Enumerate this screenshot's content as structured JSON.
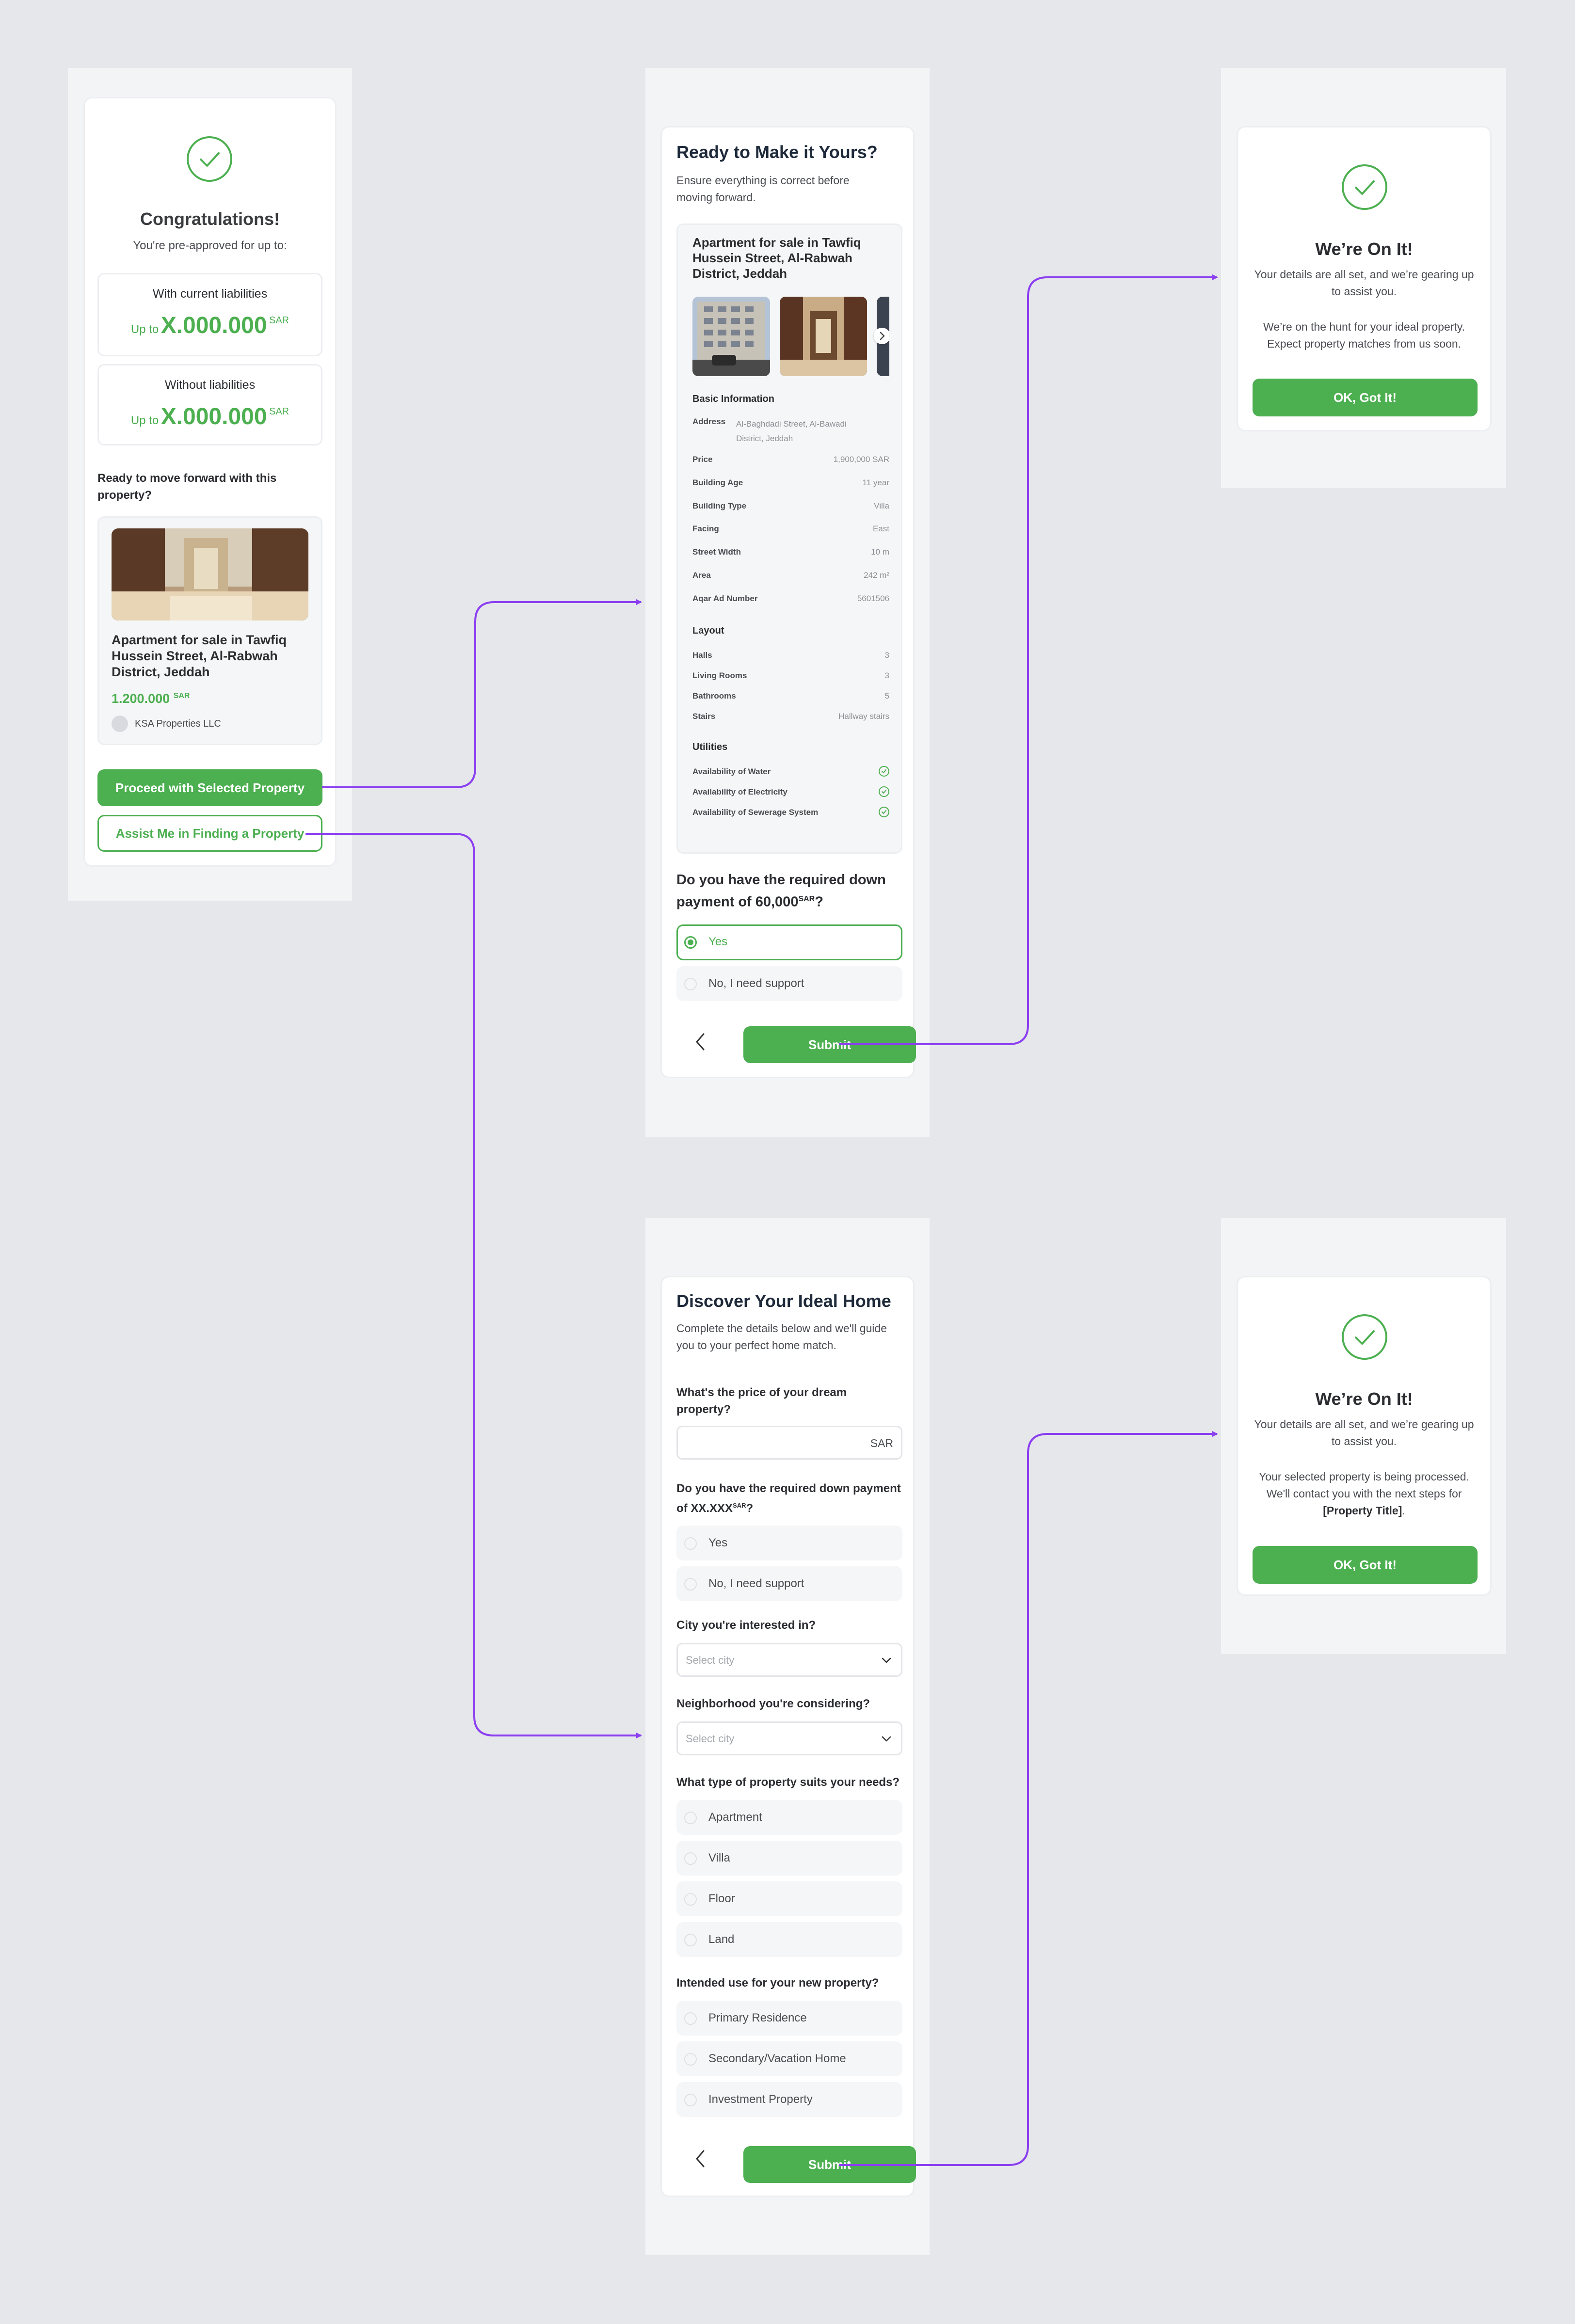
{
  "screen1": {
    "title": "Congratulations!",
    "subtitle": "You're pre-approved for up to:",
    "with_liabilities": {
      "label": "With current liabilities",
      "prefix": "Up to",
      "amount": "X.000.000",
      "currency": "SAR"
    },
    "without_liabilities": {
      "label": "Without liabilities",
      "prefix": "Up to",
      "amount": "X.000.000",
      "currency": "SAR"
    },
    "question": "Ready to move forward with this property?",
    "property": {
      "title": "Apartment for sale in Tawfiq Hussein Street, Al-Rabwah District, Jeddah",
      "price": "1.200.000",
      "currency": "SAR",
      "agency": "KSA Properties LLC"
    },
    "proceed_button": "Proceed with Selected Property",
    "assist_button": "Assist Me in Finding a Property"
  },
  "screen2": {
    "title": "Ready to Make it Yours?",
    "subtitle": "Ensure everything is correct before moving forward.",
    "property_title": "Apartment for sale in Tawfiq Hussein Street, Al-Rabwah District, Jeddah",
    "basic_info_title": "Basic Information",
    "address_label": "Address",
    "address_value": "Al-Baghdadi Street, Al-Bawadi District, Jeddah",
    "basic_info": [
      {
        "k": "Price",
        "v": "1,900,000 SAR"
      },
      {
        "k": "Building Age",
        "v": "11 year"
      },
      {
        "k": "Building Type",
        "v": "Villa"
      },
      {
        "k": "Facing",
        "v": "East"
      },
      {
        "k": "Street Width",
        "v": "10 m"
      },
      {
        "k": "Area",
        "v": "242 m²"
      },
      {
        "k": "Aqar Ad Number",
        "v": "5601506"
      }
    ],
    "layout_title": "Layout",
    "layout": [
      {
        "k": "Halls",
        "v": "3"
      },
      {
        "k": "Living Rooms",
        "v": "3"
      },
      {
        "k": "Bathrooms",
        "v": "5"
      },
      {
        "k": "Stairs",
        "v": "Hallway stairs"
      }
    ],
    "utilities_title": "Utilities",
    "utilities": [
      "Availability of Water",
      "Availability of Electricity",
      "Availability of Sewerage System"
    ],
    "question_main": "Do you have the required down payment of 60,000",
    "question_sup": "SAR",
    "question_end": "?",
    "options": [
      "Yes",
      "No, I need support"
    ],
    "submit": "Submit"
  },
  "screen3": {
    "title": "We’re On It!",
    "p1": "Your details are all set, and we’re gearing up to assist you.",
    "p2": "We’re on the hunt for your ideal property. Expect property matches from us soon.",
    "button": "OK, Got It!"
  },
  "screen4": {
    "title": "Discover Your Ideal Home",
    "subtitle": "Complete the details below and we'll guide you to your perfect home match.",
    "q_price": "What's the price of your dream property?",
    "price_currency": "SAR",
    "q_down_main": "Do you have the required down payment of XX.XXX",
    "q_down_sup": "SAR",
    "q_down_end": "?",
    "down_options": [
      "Yes",
      "No, I need support"
    ],
    "q_city": "City you're interested in?",
    "city_placeholder": "Select city",
    "q_neighborhood": "Neighborhood you're considering?",
    "neighborhood_placeholder": "Select city",
    "q_type": "What type of property suits your needs?",
    "type_options": [
      "Apartment",
      "Villa",
      "Floor",
      "Land"
    ],
    "q_use": "Intended use for your new property?",
    "use_options": [
      "Primary Residence",
      "Secondary/Vacation Home",
      "Investment Property"
    ],
    "submit": "Submit"
  },
  "screen5": {
    "title": "We’re On It!",
    "p1": "Your details are all set, and we’re gearing up to assist you.",
    "p2_pre": "Your selected property is being processed. We'll contact you with the next steps for ",
    "p2_bold": "[Property Title]",
    "p2_post": ".",
    "button": "OK, Got It!"
  },
  "colors": {
    "accent": "#4caf50",
    "flow_arrow": "#8b3ff0",
    "canvas": "#e6e7eb"
  }
}
